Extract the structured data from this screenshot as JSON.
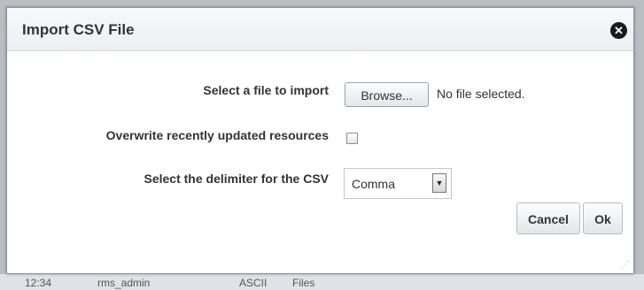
{
  "background_row": {
    "cells": [
      "12:34",
      "rms_admin",
      "ASCII",
      "Files"
    ]
  },
  "dialog": {
    "title": "Import CSV File",
    "close_icon": "close-circle-icon",
    "file_label": "Select a file to import",
    "browse_label": "Browse...",
    "file_status": "No file selected.",
    "overwrite_label": "Overwrite recently updated resources",
    "overwrite_checked": false,
    "delimiter_label": "Select the delimiter for the CSV",
    "delimiter_value": "Comma",
    "cancel_label": "Cancel",
    "ok_label": "Ok",
    "close_glyph": "✕",
    "dropdown_glyph": "▼",
    "resize_glyph": "⋰"
  },
  "colors": {
    "backdrop": "#b9bec4",
    "dialog_bg": "#ffffff",
    "title_text": "#333333"
  }
}
